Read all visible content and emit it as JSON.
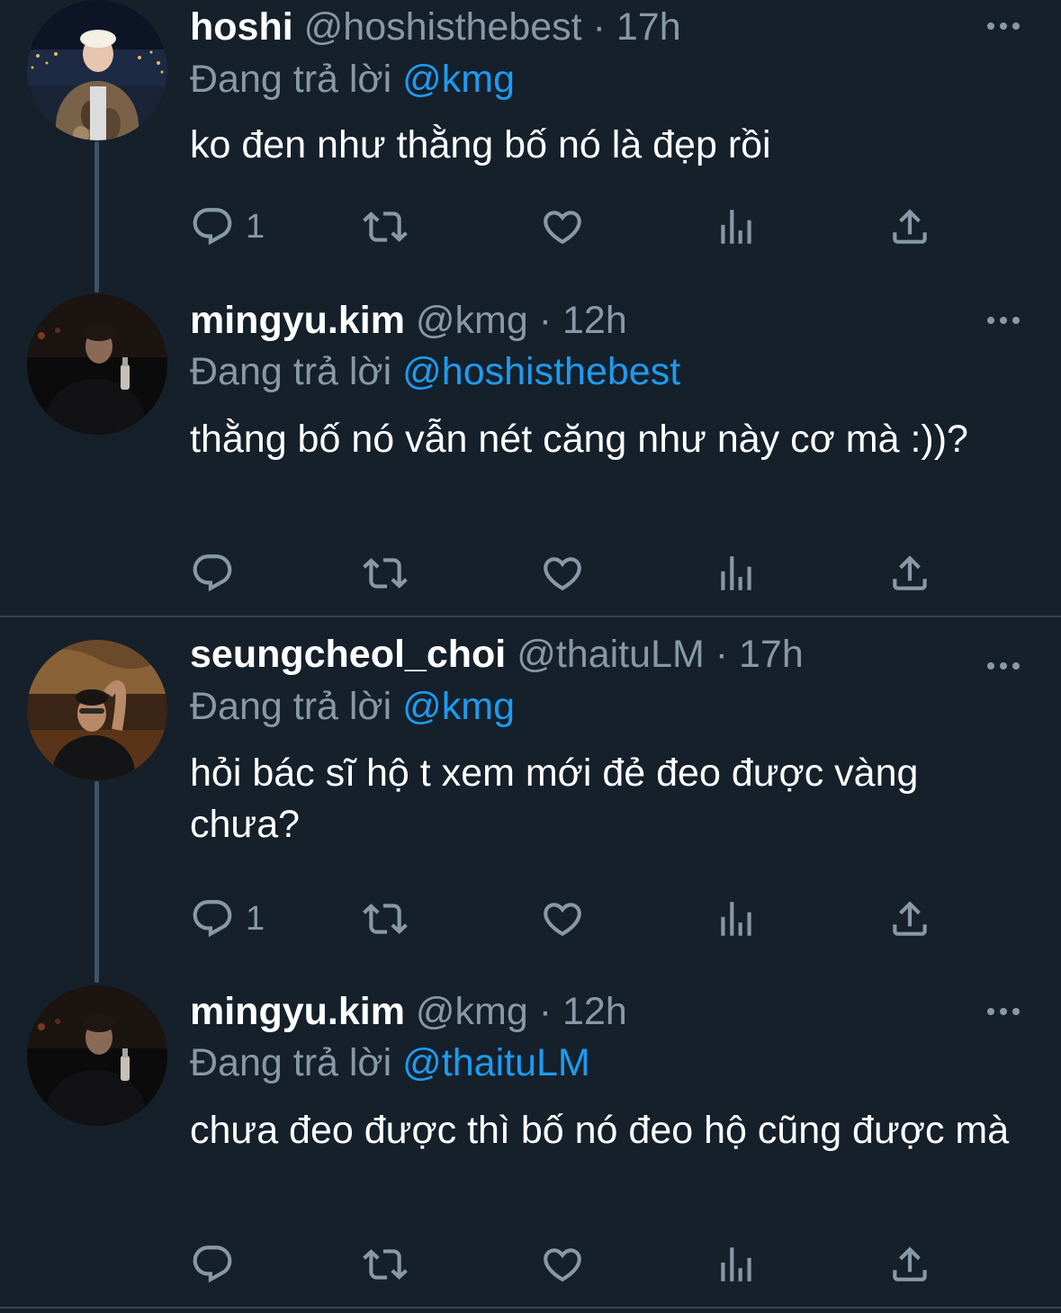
{
  "threads": [
    {
      "tweets": [
        {
          "display_name": "hoshi",
          "handle": "@hoshisthebest",
          "separator": "·",
          "time": "17h",
          "reply_label": "Đang trả lời",
          "reply_to": "@kmg",
          "text": "ko đen như thằng bố nó là đẹp rồi",
          "reply_count": "1",
          "avatar": "avatar-hoshi"
        },
        {
          "display_name": "mingyu.kim",
          "handle": "@kmg",
          "separator": "·",
          "time": "12h",
          "reply_label": "Đang trả lời",
          "reply_to": "@hoshisthebest",
          "text": "thằng bố nó vẫn nét căng như này cơ mà :))?",
          "reply_count": "",
          "avatar": "avatar-mingyu"
        }
      ]
    },
    {
      "tweets": [
        {
          "display_name": "seungcheol_choi",
          "handle": "@thaituLM",
          "separator": "·",
          "time": "17h",
          "reply_label": "Đang trả lời",
          "reply_to": "@kmg",
          "text": "hỏi bác sĩ hộ t xem mới đẻ đeo được vàng chưa?",
          "reply_count": "1",
          "avatar": "avatar-seungcheol"
        },
        {
          "display_name": "mingyu.kim",
          "handle": "@kmg",
          "separator": "·",
          "time": "12h",
          "reply_label": "Đang trả lời",
          "reply_to": "@thaituLM",
          "text": "chưa đeo được thì bố nó đeo hộ cũng được mà",
          "reply_count": "",
          "avatar": "avatar-mingyu"
        }
      ]
    }
  ],
  "icons": {
    "more": "more-icon",
    "reply": "reply-icon",
    "retweet": "retweet-icon",
    "like": "like-icon",
    "views": "views-icon",
    "share": "share-icon"
  },
  "colors": {
    "background": "#15202b",
    "secondary_text": "#8899a6",
    "link": "#1d9bf0",
    "divider": "#38444d",
    "thread_line": "#3d5466"
  }
}
